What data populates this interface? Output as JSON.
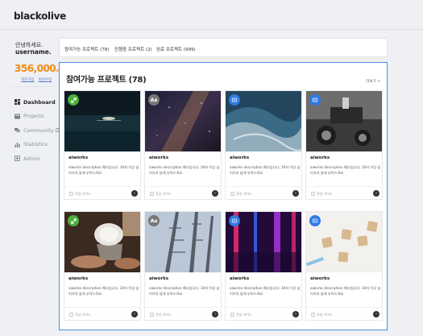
{
  "app": {
    "brand": "blackolive"
  },
  "user": {
    "greeting": "안녕하세요.",
    "name": "username.",
    "points": "356,000",
    "points_unit": "pts",
    "links": [
      "회원가입",
      "회원수정"
    ]
  },
  "nav": [
    {
      "label": "Dashboard",
      "icon": "dashboard-icon",
      "active": true
    },
    {
      "label": "Projects",
      "icon": "projects-icon",
      "active": false
    },
    {
      "label": "Community",
      "icon": "community-icon",
      "active": false
    },
    {
      "label": "Statistics",
      "icon": "statistics-icon",
      "active": false
    },
    {
      "label": "Admin",
      "icon": "admin-icon",
      "active": false
    }
  ],
  "tabs": [
    {
      "label": "참여가능 프로젝트 (78)"
    },
    {
      "label": "진행중 프로젝트 (2)"
    },
    {
      "label": "완료 프로젝트 (999)"
    }
  ],
  "panel": {
    "title": "참여가능 프로젝트 (78)",
    "more": "더보기 >"
  },
  "cards": [
    {
      "badge": "image",
      "badge_color": "#4caf3a",
      "title": "aiworks",
      "desc": "aiworks description 예시입니다. 30자 이상 넘어가지 않게 부탁드려요",
      "footer": "작업 가이드"
    },
    {
      "badge": "text",
      "badge_label": "Aa",
      "badge_color": "#777777",
      "title": "aiworks",
      "desc": "aiworks description 예시입니다. 30자 이상 넘어가지 않게 부탁드려요",
      "footer": "작업 가이드"
    },
    {
      "badge": "video",
      "badge_color": "#2f7ae5",
      "title": "aiworks",
      "desc": "aiworks description 예시입니다. 30자 이상 넘어가지 않게 부탁드려요",
      "footer": "작업 가이드"
    },
    {
      "badge": "video",
      "badge_color": "#2f7ae5",
      "title": "aiworks",
      "desc": "aiworks description 예시입니다. 30자 이상 넘어가지 않게 부탁드려요",
      "footer": "작업 가이드"
    },
    {
      "badge": "image",
      "badge_color": "#4caf3a",
      "title": "aiworks",
      "desc": "aiworks description 예시입니다. 30자 이상 넘어가지 않게 부탁드려요",
      "footer": "작업 가이드"
    },
    {
      "badge": "text",
      "badge_label": "Aa",
      "badge_color": "#777777",
      "title": "aiworks",
      "desc": "aiworks description 예시입니다. 30자 이상 넘어가지 않게 부탁드려요",
      "footer": "작업 가이드"
    },
    {
      "badge": "video",
      "badge_color": "#2f7ae5",
      "title": "aiworks",
      "desc": "aiworks description 예시입니다. 30자 이상 넘어가지 않게 부탁드려요",
      "footer": "작업 가이드"
    },
    {
      "badge": "video",
      "badge_color": "#2f7ae5",
      "title": "aiworks",
      "desc": "aiworks description 예시입니다. 30자 이상 넘어가지 않게 부탁드려요",
      "footer": "작업 가이드"
    }
  ],
  "colors": {
    "accent": "#4a8de0",
    "points": "#f28a12"
  }
}
